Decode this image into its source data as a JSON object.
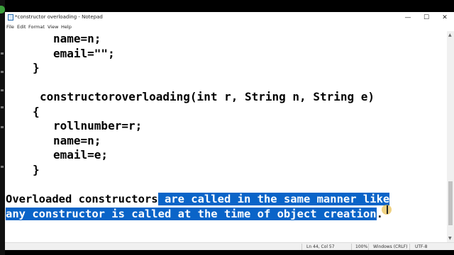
{
  "window": {
    "title": "*constructor overloading - Notepad",
    "minimize_symbol": "—",
    "maximize_symbol": "☐",
    "close_symbol": "✕"
  },
  "menu": [
    "File",
    "Edit",
    "Format",
    "View",
    "Help"
  ],
  "editor": {
    "code_lines": [
      "name=n;",
      "email=\"\";",
      "}",
      "constructoroverloading(int r, String n, String e)",
      "{",
      "rollnumber=r;",
      "name=n;",
      "email=e;",
      "}"
    ],
    "prose": {
      "line1_unselected": "Overloaded constructors",
      "line1_selected": " are called in the same manner like",
      "line2_selected": "any constructor is called at the time of object creation",
      "line2_trailing": "."
    },
    "selection_color": "#0a64c8"
  },
  "status_bar": {
    "position": "Ln 44, Col 57",
    "zoom": "100%",
    "line_ending": "Windows (CRLF)",
    "encoding": "UTF-8"
  },
  "icons": [
    "notepad-app-icon",
    "minimize-icon",
    "maximize-icon",
    "close-icon",
    "scroll-up-arrow-icon",
    "scroll-down-arrow-icon",
    "text-cursor-icon"
  ]
}
